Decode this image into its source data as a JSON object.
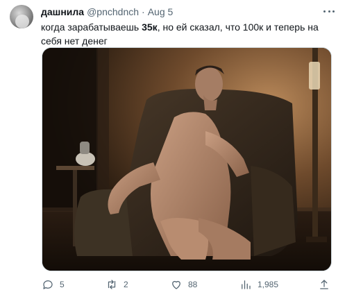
{
  "tweet": {
    "display_name": "дашнила",
    "handle": "@pnchdnch",
    "separator": "·",
    "date": "Aug 5",
    "text_before": "когда зарабатываешь ",
    "text_bold": "35к",
    "text_after": ", но ей сказал, что 100к и теперь на себя нет денег"
  },
  "actions": {
    "replies": "5",
    "retweets": "2",
    "likes": "88",
    "views": "1,985"
  },
  "icons": {
    "more": "more-icon",
    "reply": "reply-icon",
    "retweet": "retweet-icon",
    "like": "heart-icon",
    "views": "views-icon",
    "share": "share-icon"
  }
}
